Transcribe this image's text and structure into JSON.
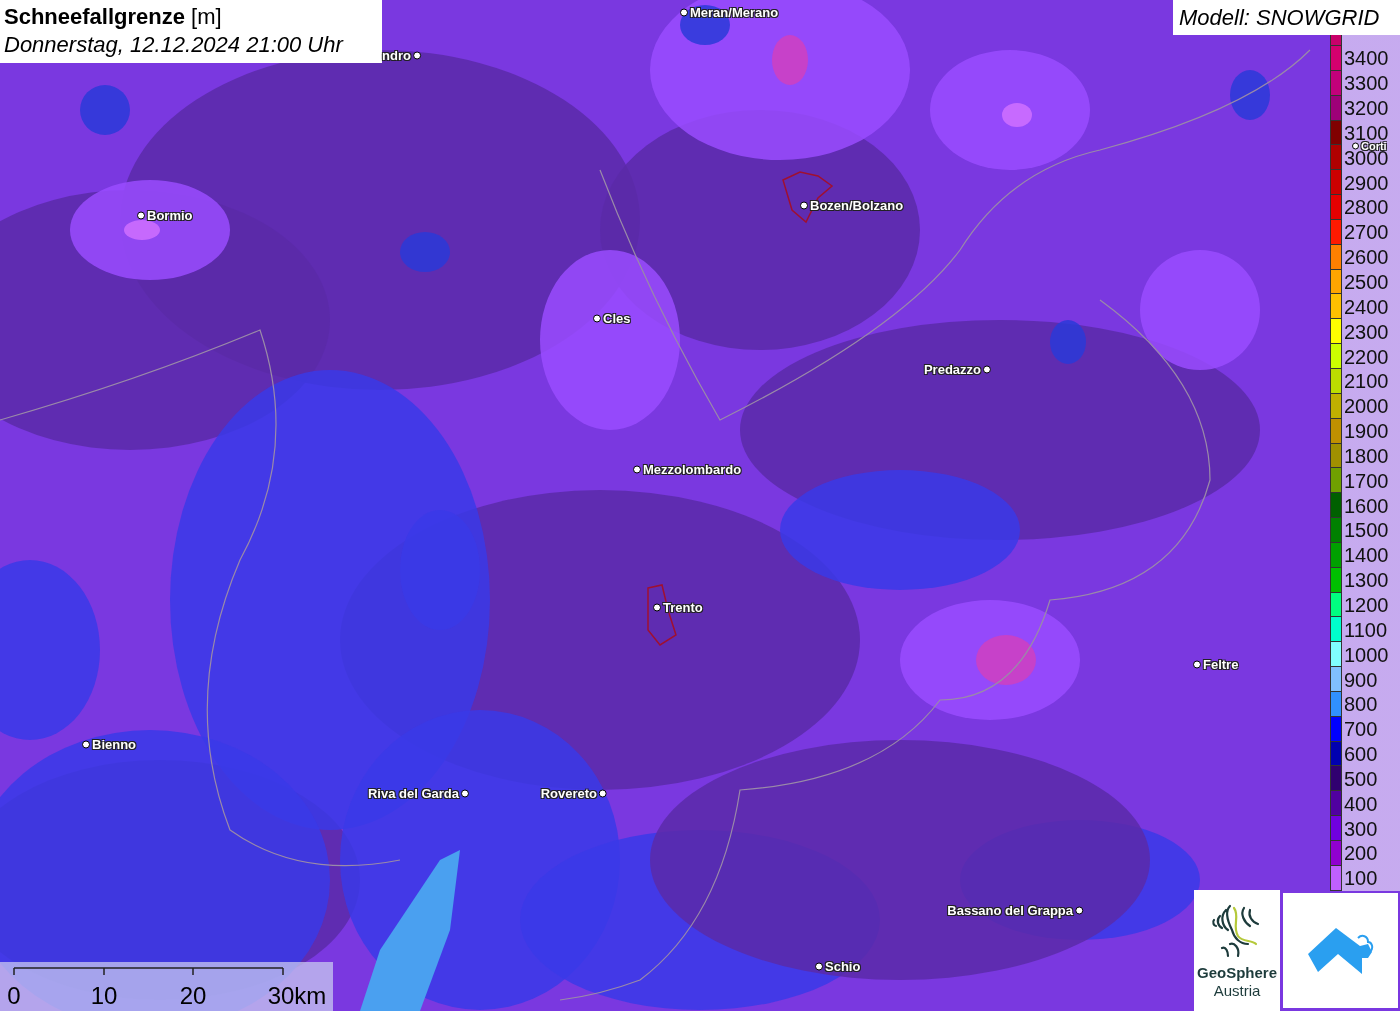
{
  "title": {
    "heading": "**Schneefallgrenze** [m]",
    "subtitle": "Donnerstag, 12.12.2024 21:00 Uhr"
  },
  "model": "Modell: SNOWGRID",
  "cities": [
    {
      "name": "ndro"
    },
    {
      "name": "Meran/Merano"
    },
    {
      "name": "Bormio"
    },
    {
      "name": "Bozen/Bolzano"
    },
    {
      "name": "Cles"
    },
    {
      "name": "Predazzo"
    },
    {
      "name": "Mezzolombardo"
    },
    {
      "name": "Trento"
    },
    {
      "name": "Feltre"
    },
    {
      "name": "Bienno"
    },
    {
      "name": "Riva del Garda"
    },
    {
      "name": "Rovereto"
    },
    {
      "name": "Bassano del Grappa"
    },
    {
      "name": "Schio"
    },
    {
      "name": "Corti"
    }
  ],
  "legend": [
    {
      "label": "3400",
      "color": "#d4006e"
    },
    {
      "label": "3300",
      "color": "#c2007a"
    },
    {
      "label": "3200",
      "color": "#9e0078"
    },
    {
      "label": "3100",
      "color": "#800000"
    },
    {
      "label": "3000",
      "color": "#b00000"
    },
    {
      "label": "2900",
      "color": "#cc0000"
    },
    {
      "label": "2800",
      "color": "#e60000"
    },
    {
      "label": "2700",
      "color": "#ff1a00"
    },
    {
      "label": "2600",
      "color": "#ff8000"
    },
    {
      "label": "2500",
      "color": "#ffa500"
    },
    {
      "label": "2400",
      "color": "#ffc000"
    },
    {
      "label": "2300",
      "color": "#ffff00"
    },
    {
      "label": "2200",
      "color": "#ccff00"
    },
    {
      "label": "2100",
      "color": "#bbdd00"
    },
    {
      "label": "2000",
      "color": "#c0b000"
    },
    {
      "label": "1900",
      "color": "#c09000"
    },
    {
      "label": "1800",
      "color": "#a09000"
    },
    {
      "label": "1700",
      "color": "#70a000"
    },
    {
      "label": "1600",
      "color": "#006000"
    },
    {
      "label": "1500",
      "color": "#008000"
    },
    {
      "label": "1400",
      "color": "#00a000"
    },
    {
      "label": "1300",
      "color": "#00c000"
    },
    {
      "label": "1200",
      "color": "#00ff80"
    },
    {
      "label": "1100",
      "color": "#00ffcc"
    },
    {
      "label": "1000",
      "color": "#80ffff"
    },
    {
      "label": "900",
      "color": "#80c0ff"
    },
    {
      "label": "800",
      "color": "#3090ff"
    },
    {
      "label": "700",
      "color": "#0000ff"
    },
    {
      "label": "600",
      "color": "#0000b0"
    },
    {
      "label": "500",
      "color": "#300070"
    },
    {
      "label": "400",
      "color": "#5000a0"
    },
    {
      "label": "300",
      "color": "#7000e0"
    },
    {
      "label": "200",
      "color": "#9000d0"
    },
    {
      "label": "100",
      "color": "#c060ff"
    }
  ],
  "scale": [
    "0",
    "10",
    "20",
    "30km"
  ],
  "logo": {
    "line_1": "GeoSphere",
    "line_2": "Austria"
  }
}
